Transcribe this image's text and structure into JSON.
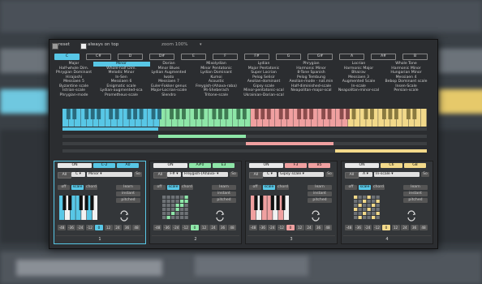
{
  "topbar": {
    "reset_label": "reset",
    "always_on_top_label": "always on top",
    "zoom_label": "zoom 100%"
  },
  "roots": [
    "C",
    "C#",
    "D",
    "D#",
    "E",
    "F",
    "F#",
    "G",
    "G#",
    "A",
    "A#",
    "B"
  ],
  "selected_root": "C",
  "scale_columns": [
    [
      "Major",
      "Half-whole Dim.",
      "Phrygian Dominant",
      "Hirajoshi",
      "Messiaen 5",
      "Byzantine scale",
      "Istrian-scale",
      "Phrygian-mode"
    ],
    [
      "Minor",
      "Whole-half Dim.",
      "Melodic Minor",
      "In-Sen",
      "Messiaen 6",
      "Enigmatic scale",
      "Lydian-augmented-sca",
      "Prometheus-scale"
    ],
    [
      "Dorian",
      "Minor Blues",
      "Lydian Augmented",
      "Iwato",
      "Messiaen 7",
      "Euler-Fokker genus",
      "Major-Locrian-scale",
      "Slendro"
    ],
    [
      "Mixolydian",
      "Minor Pentatonic",
      "Lydian Dominant",
      "Kumoi",
      "Acoustic",
      "Freygish-(Ahava-raba)",
      "Mi-Sheberach",
      "Tritone-scale"
    ],
    [
      "Lydian",
      "Major Pentatonic",
      "Super Locrian",
      "Pelog Selisir",
      "Aeolian-dominant",
      "Gipsy scale",
      "Minor-pentatonic-scal",
      "Ukrainian-Dorian-scal"
    ],
    [
      "Phrygian",
      "Harmonic Minor",
      "8-Tone Spanish",
      "Pelog Tembung",
      "Aeolian-mode - nat.min",
      "Half-diminished-scale",
      "Neapolitan-major-scal"
    ],
    [
      "Locrian",
      "Harmonic Major",
      "Bhairav",
      "Messiaen 3",
      "Augmented Scale",
      "In-scale",
      "Neapolitan-minor-scal"
    ],
    [
      "Whole Tone",
      "Harmonic Minor",
      "Hungarian Minor",
      "Messiaen 4",
      "Bebop Dominant scale",
      "Insen-Scale",
      "Persian-scale"
    ]
  ],
  "selected_scale": "Minor",
  "colors": {
    "cyan": "#58c7e6",
    "green": "#8ee6a8",
    "pink": "#f0a0a0",
    "yellow": "#f2d98a"
  },
  "panels": [
    {
      "index": "1",
      "on": "ON",
      "note_low": "C-2",
      "note_high": "A0",
      "root": "C",
      "scale": "Minor",
      "mode": "scale",
      "color": "#58c7e6",
      "active": true
    },
    {
      "index": "2",
      "on": "ON",
      "note_low": "A#0",
      "note_high": "E3",
      "root": "F#",
      "scale": "Freygish-(Ahava-",
      "mode": "scale",
      "color": "#8ee6a8",
      "active": false
    },
    {
      "index": "3",
      "on": "ON",
      "note_low": "F3",
      "note_high": "B5",
      "root": "C",
      "scale": "Gipsy scale",
      "mode": "scale",
      "color": "#f0a0a0",
      "active": false
    },
    {
      "index": "4",
      "on": "ON",
      "note_low": "C6",
      "note_high": "G8",
      "root": "A",
      "scale": "In-scale",
      "mode": "scale",
      "color": "#f2d98a",
      "active": false
    }
  ],
  "panel_controls": {
    "all": "All",
    "so": "So",
    "modes": [
      "off",
      "scale",
      "chord"
    ],
    "options": [
      "learn",
      "instant",
      "pitched"
    ]
  },
  "octaves": [
    "-48",
    "-36",
    "-24",
    "-12",
    "0",
    "12",
    "24",
    "36",
    "48"
  ]
}
